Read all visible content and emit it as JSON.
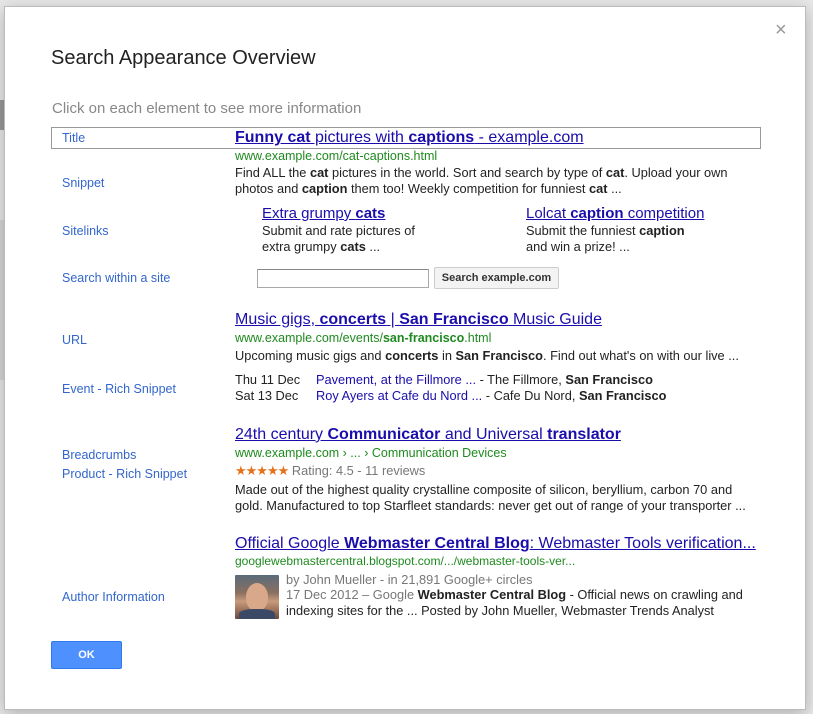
{
  "dialog": {
    "title": "Search Appearance Overview",
    "instruction": "Click on each element to see more information",
    "close_label": "×",
    "ok_label": "OK"
  },
  "labels": {
    "title": "Title",
    "snippet": "Snippet",
    "sitelinks": "Sitelinks",
    "search_within": "Search within a site",
    "url": "URL",
    "event": "Event - Rich Snippet",
    "breadcrumbs": "Breadcrumbs",
    "product": "Product - Rich Snippet",
    "author": "Author Information"
  },
  "result1": {
    "title_a": "Funny cat",
    "title_b": " pictures with ",
    "title_c": "captions",
    "title_d": " - example.com",
    "url": "www.example.com/cat-captions.html",
    "snip1_a": "Find ALL the ",
    "snip1_b": "cat",
    "snip1_c": " pictures in the world. Sort and search by type of ",
    "snip1_d": "cat",
    "snip1_e": ". Upload your own",
    "snip2_a": "photos and ",
    "snip2_b": "caption",
    "snip2_c": " them too! Weekly competition for funniest ",
    "snip2_d": "cat",
    "snip2_e": " ...",
    "sitelink1": {
      "title_a": "Extra grumpy ",
      "title_b": "cats",
      "line1": "Submit and rate pictures of",
      "line2_a": "extra grumpy ",
      "line2_b": "cats",
      "line2_c": " ..."
    },
    "sitelink2": {
      "title_a": "Lolcat ",
      "title_b": "caption",
      "title_c": " competition",
      "line1_a": "Submit the funniest ",
      "line1_b": "caption",
      "line2": "and win a prize! ..."
    },
    "search_button": "Search example.com"
  },
  "result2": {
    "title_a": "Music gigs, ",
    "title_b": "concerts",
    "title_c": " | ",
    "title_d": "San Francisco",
    "title_e": " Music Guide",
    "url_a": "www.example.com/events/",
    "url_b": "san-francisco",
    "url_c": ".html",
    "snip_a": "Upcoming music gigs and ",
    "snip_b": "concerts",
    "snip_c": " in ",
    "snip_d": "San Francisco",
    "snip_e": ". Find out what's on with our live ...",
    "events": [
      {
        "date": "Thu 11 Dec",
        "link": "Pavement, at the Fillmore ...",
        "venue_a": " - The Fillmore, ",
        "venue_b": "San Francisco"
      },
      {
        "date": "Sat 13 Dec",
        "link": "Roy Ayers at Cafe du Nord ...",
        "venue_a": " - Cafe Du Nord, ",
        "venue_b": "San Francisco"
      }
    ]
  },
  "result3": {
    "title_a": "24th century ",
    "title_b": "Communicator",
    "title_c": " and Universal ",
    "title_d": "translator",
    "breadcrumb": "www.example.com › ... › Communication Devices",
    "stars": "★★★★★",
    "rating": "Rating: 4.5 - 11 reviews",
    "rating_value": 4.5,
    "snip1": "Made out of the highest quality crystalline composite of silicon, beryllium, carbon 70 and",
    "snip2": "gold. Manufactured to top Starfleet standards: never get out of range of your transporter ..."
  },
  "result4": {
    "title_a": "Official Google ",
    "title_b": "Webmaster Central Blog",
    "title_c": ": Webmaster Tools verification...",
    "url": "googlewebmastercentral.blogspot.com/.../webmaster-tools-ver...",
    "author": "by John Mueller - in 21,891 Google+ circles",
    "snip1_a": "17 Dec 2012 – Google ",
    "snip1_b": "Webmaster Central Blog",
    "snip1_c": " - Official news on crawling and",
    "snip2": "indexing  sites for the ... Posted by John Mueller, Webmaster Trends Analyst"
  },
  "colors": {
    "link": "#1a0dab",
    "url_green": "#1e8a1e",
    "label_blue": "#3366cc",
    "ok_button": "#4d90fe",
    "star_orange": "#e7711b"
  }
}
